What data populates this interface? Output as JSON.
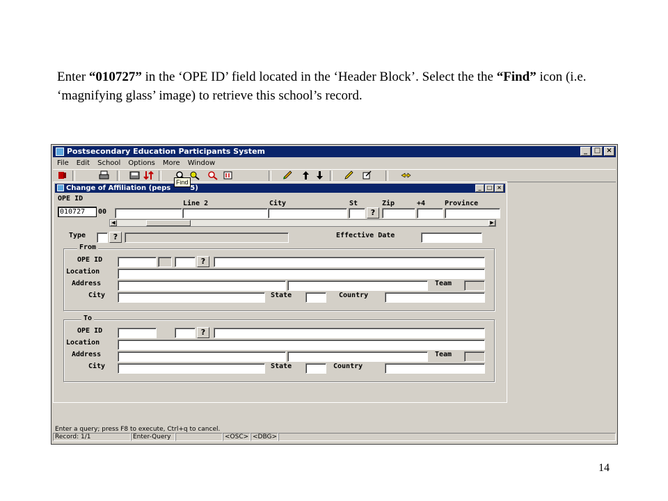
{
  "instruction": {
    "p1": "Enter ",
    "q1": "“010727”",
    "p2": " in the ‘OPE ID’ field located in the ‘Header Block’.  Select the the ",
    "q2": "“Find”",
    "p3": " icon (i.e. ‘magnifying glass’ image) to retrieve this school’s record."
  },
  "page_number": "14",
  "app": {
    "title": "Postsecondary Education Participants System",
    "menu": [
      "File",
      "Edit",
      "School",
      "Options",
      "More",
      "Window"
    ],
    "tooltip": "Find"
  },
  "form": {
    "title": "Change of Affiliation (peps",
    "title_tail": "5)",
    "header": {
      "ope_label": "OPE ID",
      "ope_value": "010727",
      "ope_suffix": "00",
      "line2_label": "Line 2",
      "city_label": "City",
      "st_label": "St",
      "zip_label": "Zip",
      "plus4_label": "+4",
      "province_label": "Province"
    },
    "type_label": "Type",
    "effective_date_label": "Effective Date",
    "from": {
      "title": "From",
      "ope_label": "OPE ID",
      "location_label": "Location",
      "address_label": "Address",
      "team_label": "Team",
      "city_label": "City",
      "state_label": "State",
      "country_label": "Country"
    },
    "to": {
      "title": "To",
      "ope_label": "OPE ID",
      "location_label": "Location",
      "address_label": "Address",
      "team_label": "Team",
      "city_label": "City",
      "state_label": "State",
      "country_label": "Country"
    }
  },
  "status": {
    "message": "Enter a query;  press F8 to execute, Ctrl+q  to cancel.",
    "record": "Record: 1/1",
    "mode": "Enter-Query",
    "osc": "<OSC>",
    "dbg": "<DBG>"
  },
  "colors": {
    "title_bar": "#0a246a",
    "face": "#d4d0c8",
    "mdi_bg": "#808080",
    "tooltip": "#ffffe1"
  }
}
